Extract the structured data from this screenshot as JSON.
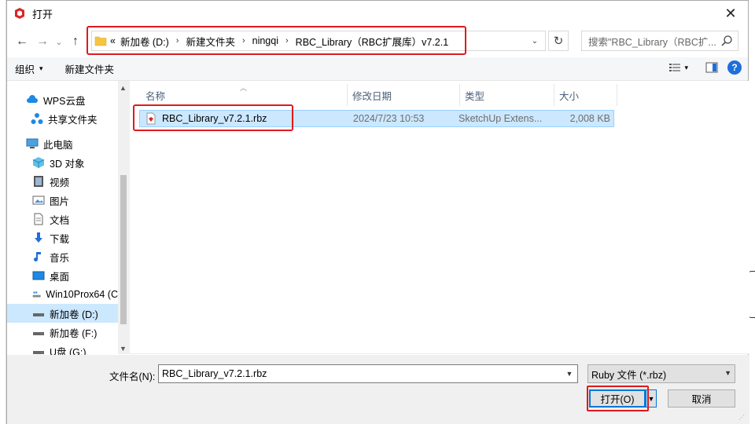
{
  "window": {
    "title": "打开",
    "close_label": "✕"
  },
  "nav": {
    "back_label": "←",
    "forward_label": "→",
    "recent_label": "⌄",
    "up_label": "↑"
  },
  "address": {
    "overflow_label": "«",
    "crumbs": [
      "新加卷 (D:)",
      "新建文件夹",
      "ningqi",
      "RBC_Library（RBC扩展库）v7.2.1"
    ],
    "separator": "›",
    "dropdown_label": "⌄",
    "refresh_label": "↻"
  },
  "search": {
    "placeholder": "搜索\"RBC_Library（RBC扩..."
  },
  "toolbar": {
    "organize_label": "组织",
    "new_folder_label": "新建文件夹",
    "view_caret": "▾",
    "help_label": "?"
  },
  "sidebar": {
    "items": [
      {
        "label": "WPS云盘",
        "icon": "cloud-icon"
      },
      {
        "label": "共享文件夹",
        "icon": "share-icon"
      },
      {
        "label": "此电脑",
        "icon": "computer-icon"
      },
      {
        "label": "3D 对象",
        "icon": "cube-icon"
      },
      {
        "label": "视频",
        "icon": "video-icon"
      },
      {
        "label": "图片",
        "icon": "picture-icon"
      },
      {
        "label": "文档",
        "icon": "document-icon"
      },
      {
        "label": "下载",
        "icon": "download-icon"
      },
      {
        "label": "音乐",
        "icon": "music-icon"
      },
      {
        "label": "桌面",
        "icon": "desktop-icon"
      },
      {
        "label": "Win10Prox64 (C",
        "icon": "drive-c-icon"
      },
      {
        "label": "新加卷 (D:)",
        "icon": "drive-icon",
        "selected": true
      },
      {
        "label": "新加卷 (F:)",
        "icon": "drive-icon"
      },
      {
        "label": "U盘 (G:)",
        "icon": "usb-icon"
      }
    ]
  },
  "columns": {
    "name": "名称",
    "modified": "修改日期",
    "type": "类型",
    "size": "大小"
  },
  "files": [
    {
      "name": "RBC_Library_v7.2.1.rbz",
      "modified": "2024/7/23 10:53",
      "type": "SketchUp Extens...",
      "size": "2,008 KB"
    }
  ],
  "footer": {
    "filename_label": "文件名(N):",
    "filename_value": "RBC_Library_v7.2.1.rbz",
    "filetype_value": "Ruby 文件 (*.rbz)",
    "open_label": "打开(O)",
    "cancel_label": "取消"
  },
  "colors": {
    "highlight": "#e0191e",
    "selection": "#cce8ff",
    "accent": "#0078d7"
  }
}
